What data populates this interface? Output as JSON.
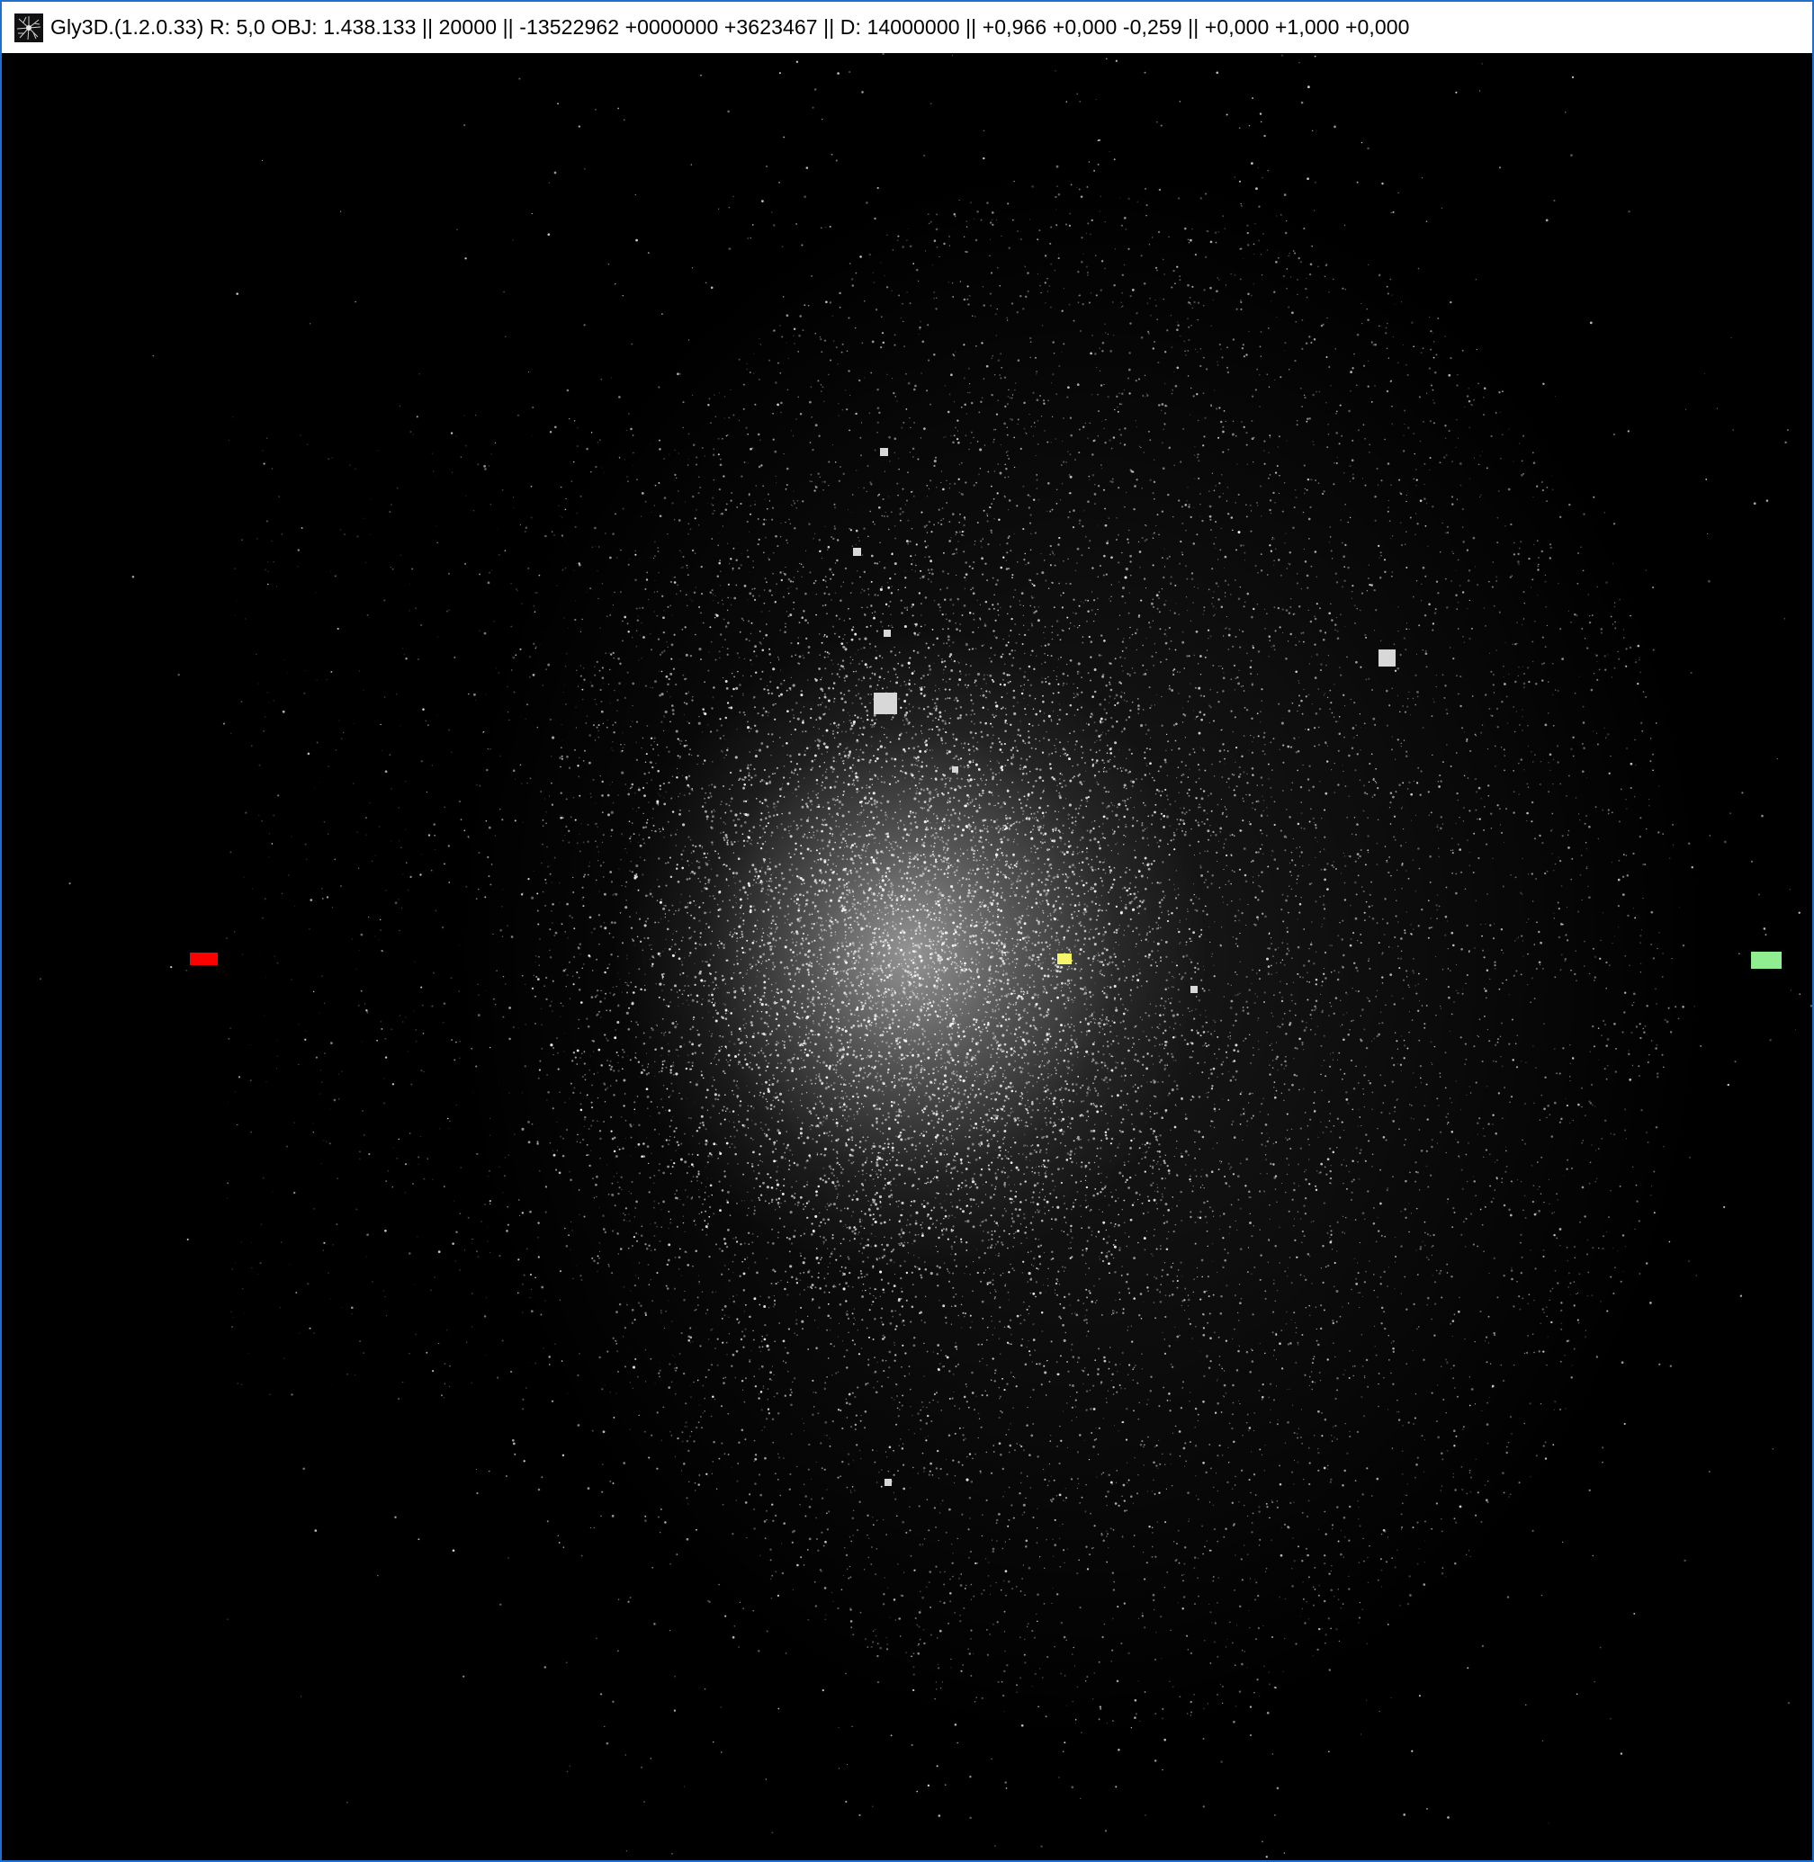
{
  "window": {
    "title": "Gly3D.(1.2.0.33) R: 5,0 OBJ: 1.438.133 || 20000 || -13522962 +0000000 +3623467 || D: 14000000 || +0,966 +0,000 -0,259 || +0,000 +1,000 +0,000",
    "icon": "gly3d-app-icon"
  },
  "viewport": {
    "background": "#000000",
    "point_color": "#ffffff"
  },
  "markers": {
    "red": "#ff0000",
    "green": "#90ee90",
    "yellow": "#f5f56a"
  }
}
